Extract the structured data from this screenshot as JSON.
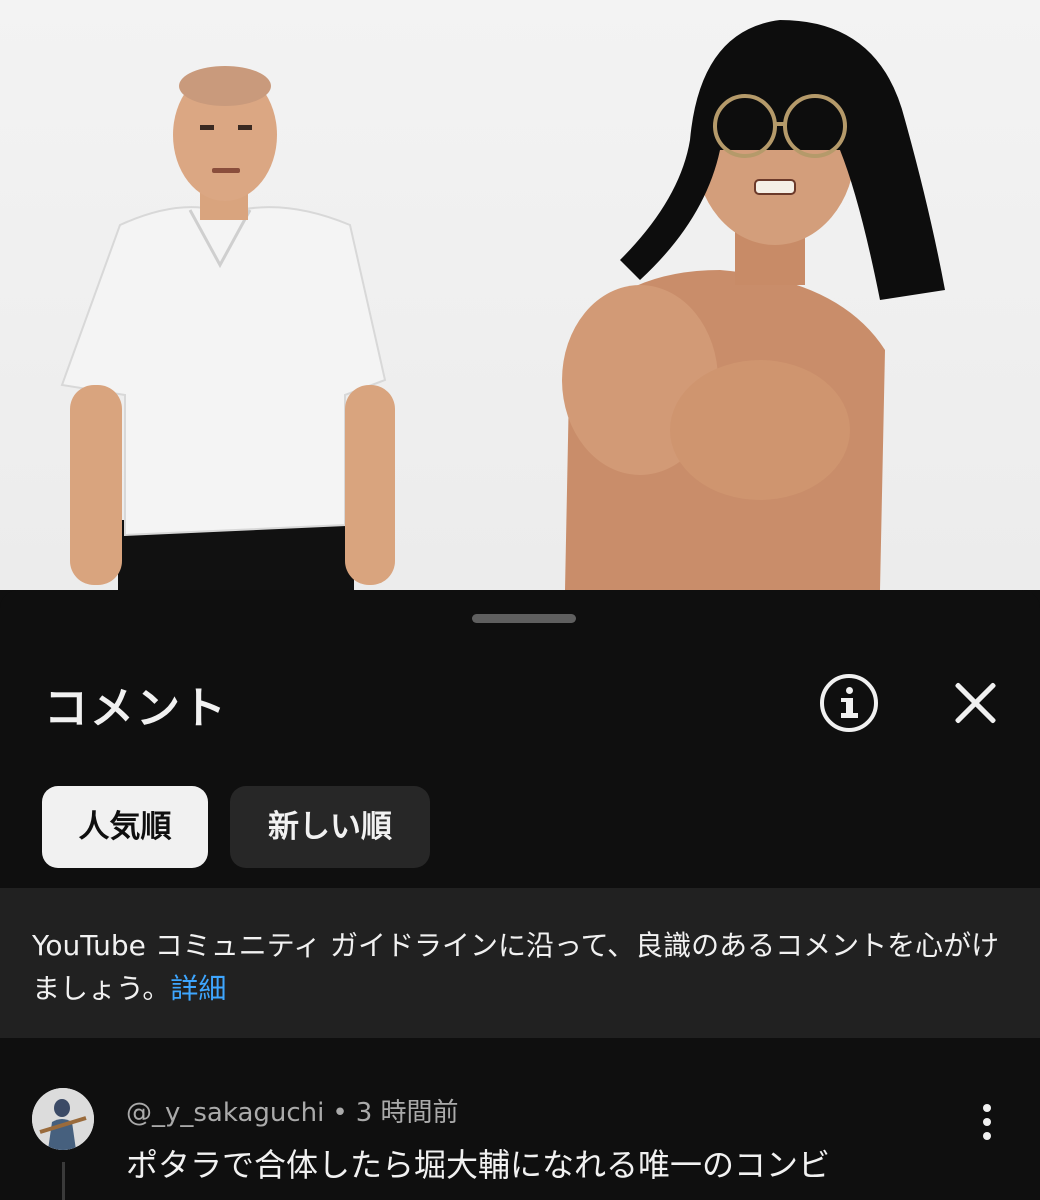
{
  "video": {
    "description_icon": "video-still-frame"
  },
  "comments_sheet": {
    "title": "コメント",
    "icons": {
      "info": "info-icon",
      "close": "close-icon"
    },
    "sort_chips": [
      {
        "label": "人気順",
        "selected": true
      },
      {
        "label": "新しい順",
        "selected": false
      }
    ],
    "guideline_notice": {
      "text": "YouTube コミュニティ ガイドラインに沿って、良識のあるコメントを心がけましょう。",
      "link_label": "詳細"
    },
    "comments": [
      {
        "author": "@_y_sakaguchi",
        "separator": "•",
        "time": "3 時間前",
        "text": "ポタラで合体したら堀大輔になれる唯一のコンビ"
      }
    ]
  },
  "colors": {
    "background": "#0f0f0f",
    "notice_background": "#212121",
    "chip_selected": "#f1f1f1",
    "chip_unselected": "#272727",
    "link": "#3ea6ff",
    "secondary_text": "#aaaaaa"
  }
}
